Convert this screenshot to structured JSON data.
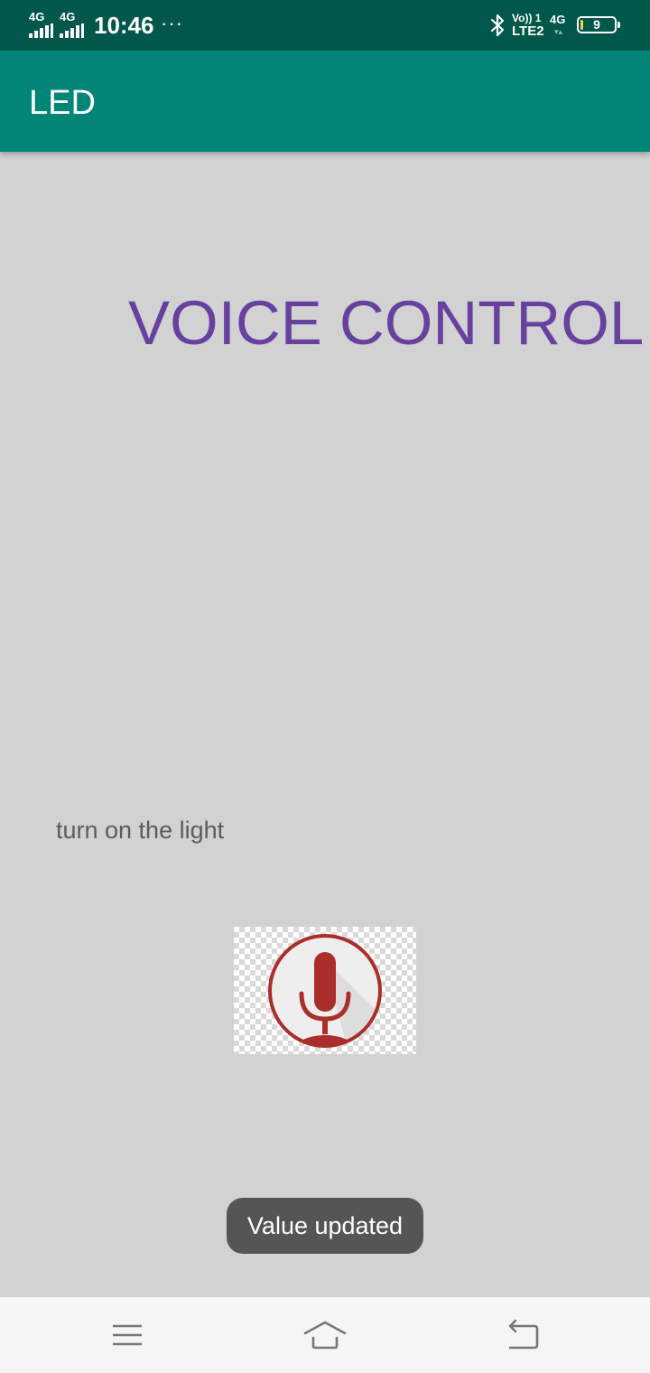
{
  "status_bar": {
    "sim1_network": "4G",
    "sim2_network": "4G",
    "time": "10:46",
    "more_indicator": "···",
    "bluetooth_icon": "bluetooth-icon",
    "volte_top": "Vo)) 1",
    "volte_bottom": "LTE2",
    "data_network": "4G",
    "battery_level": "9",
    "battery_fill_fraction": 0.09,
    "colors": {
      "background": "#00574a",
      "battery_fill": "#f4d03f"
    }
  },
  "app_bar": {
    "title": "LED",
    "color": "#008577"
  },
  "main": {
    "heading": "VOICE CONTROL",
    "heading_color": "#6841a0",
    "recognized_text": "turn on the light",
    "mic_button_icon": "microphone-icon",
    "mic_color": "#aa2f2a"
  },
  "toast": {
    "message": "Value updated"
  },
  "nav_bar": {
    "menu_icon": "menu-icon",
    "home_icon": "home-icon",
    "back_icon": "back-icon"
  }
}
